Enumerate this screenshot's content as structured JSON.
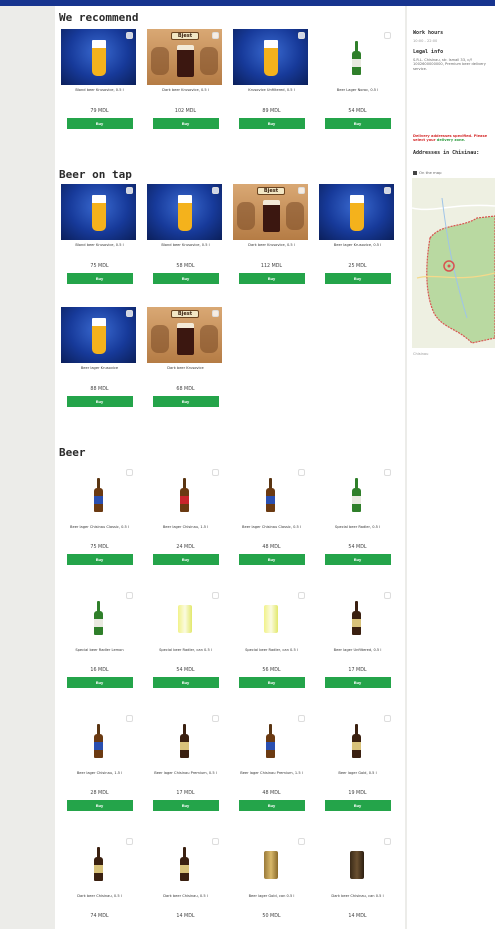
{
  "sections": {
    "recommend": "We recommend",
    "tap": "Beer on tap",
    "beer": "Beer"
  },
  "buy_label": "Buy",
  "recommend": [
    {
      "name": "Blond beer Krusovice, 0.5 l",
      "price": "79 MDL"
    },
    {
      "name": "Dark beer Krusovice, 0.5 l",
      "price": "102 MDL"
    },
    {
      "name": "Krusovice Unfiltered, 0.5 l",
      "price": "89 MDL"
    },
    {
      "name": "Beer Lager Noroc, 0.5 l",
      "price": "54 MDL"
    }
  ],
  "tap": [
    {
      "name": "Blond beer Krusovice, 0.5 l",
      "price": "75 MDL"
    },
    {
      "name": "Blond beer Krusovice, 0.5 l",
      "price": "58 MDL"
    },
    {
      "name": "Dark beer Krusovice, 0.5 l",
      "price": "112 MDL"
    },
    {
      "name": "Beer lager Krusovice, 0.5 l",
      "price": "25 MDL"
    },
    {
      "name": "Beer lager Krusovice",
      "price": "88 MDL"
    },
    {
      "name": "Dark beer Krusovice",
      "price": "68 MDL"
    }
  ],
  "beer": [
    {
      "name": "Beer lager Chisinau Classic, 0.5 l",
      "price": "75 MDL"
    },
    {
      "name": "Beer lager Chisinau, 1.5 l",
      "price": "24 MDL"
    },
    {
      "name": "Beer lager Chisinau Classic, 0.5 l",
      "price": "48 MDL"
    },
    {
      "name": "Special beer Radler, 0.5 l",
      "price": "54 MDL"
    },
    {
      "name": "Special beer Radler Lemon",
      "price": "16 MDL"
    },
    {
      "name": "Special beer Radler, can 0.5 l",
      "price": "54 MDL"
    },
    {
      "name": "Special beer Radler, can 0.5 l",
      "price": "56 MDL"
    },
    {
      "name": "Beer lager Unfiltered, 0.5 l",
      "price": "17 MDL"
    },
    {
      "name": "Beer lager Chisinau, 1.5 l",
      "price": "28 MDL"
    },
    {
      "name": "Beer lager Chisinau Premium, 0.5 l",
      "price": "17 MDL"
    },
    {
      "name": "Beer lager Chisinau Premium, 1.5 l",
      "price": "48 MDL"
    },
    {
      "name": "Beer lager Gold, 0.5 l",
      "price": "19 MDL"
    },
    {
      "name": "Dark beer Chisinau, 0.5 l",
      "price": "74 MDL"
    },
    {
      "name": "Dark beer Chisinau, 0.5 l",
      "price": "14 MDL"
    },
    {
      "name": "Beer lager Gold, can 0.5 l",
      "price": "50 MDL"
    },
    {
      "name": "Dark beer Chisinau, can 0.5 l",
      "price": "14 MDL"
    }
  ],
  "sidebar": {
    "work_hours_title": "Work hours",
    "hours": "10:00 - 22:00",
    "legal_title": "Legal info",
    "legal_text": "S.R.L. Chisinau, str. Ismail 33, c/f 1002600000000, Premium beer delivery service.",
    "warning": "Delivery addresses specified. Please select your",
    "warning_link": "delivery zone.",
    "addresses_title": "Addresses in Chisinau:",
    "check_label": "On the map",
    "map_footer": "Chisinau"
  }
}
